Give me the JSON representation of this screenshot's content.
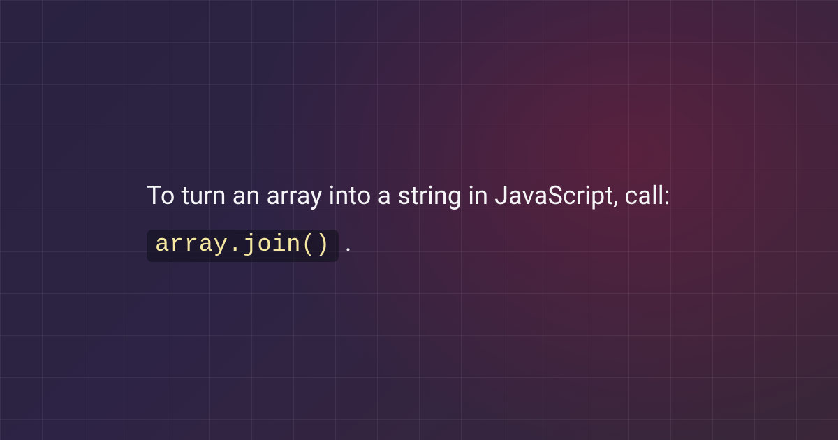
{
  "card": {
    "text_before_code": "To turn an array into a string in JavaScript, call: ",
    "code": "array.join()",
    "text_after_code": " ."
  },
  "colors": {
    "bg_primary": "#2a2240",
    "bg_accent": "#3a2638",
    "text": "#f5f5f7",
    "code_text": "#f6e7a1",
    "code_bg": "rgba(15,15,25,0.55)"
  }
}
